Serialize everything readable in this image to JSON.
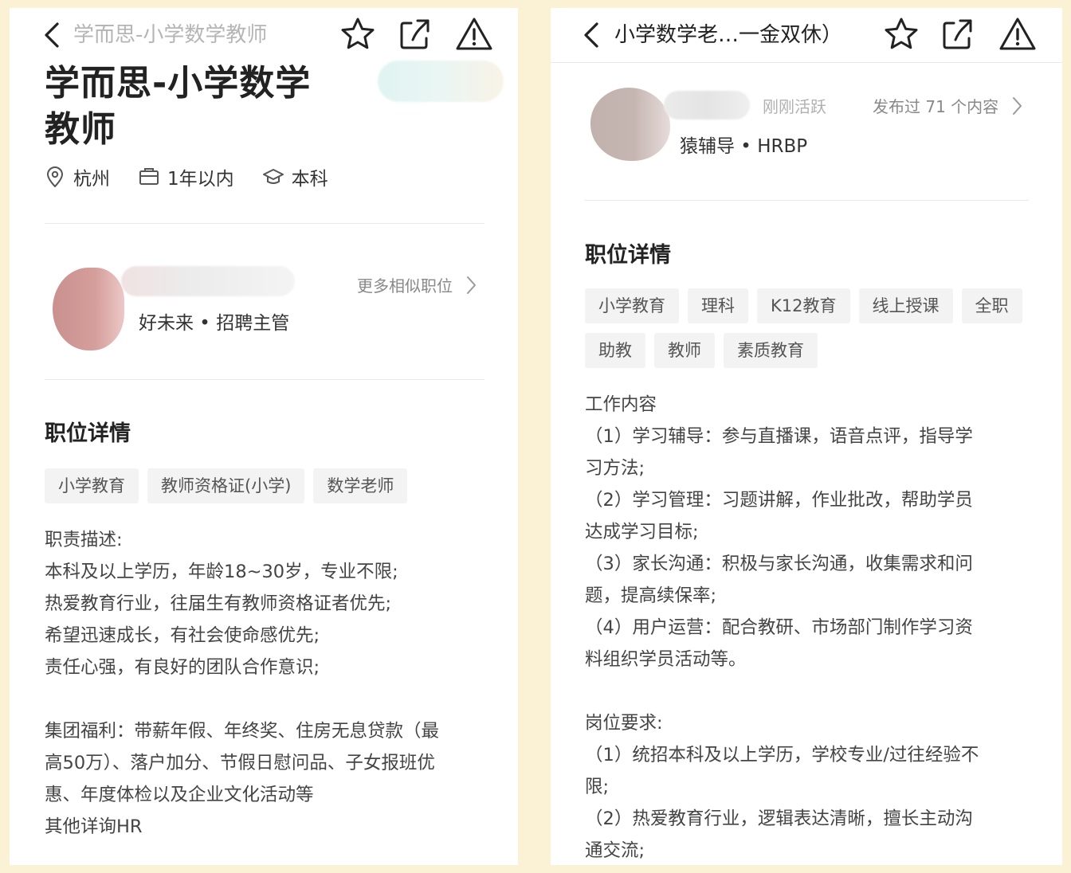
{
  "left": {
    "nav_title": "学而思-小学数学教师",
    "job_title_line1": "学而思-小学数学",
    "job_title_line2": "教师",
    "meta": {
      "location": "杭州",
      "experience": "1年以内",
      "education": "本科"
    },
    "recruiter_role": "好未来 • 招聘主管",
    "more_link": "更多相似职位",
    "section_title": "职位详情",
    "tags": [
      "小学教育",
      "教师资格证(小学)",
      "数学老师"
    ],
    "description_lines": [
      "职责描述:",
      "本科及以上学历，年龄18~30岁，专业不限;",
      "热爱教育行业，往届生有教师资格证者优先;",
      "希望迅速成长，有社会使命感优先;",
      "责任心强，有良好的团队合作意识;",
      "",
      "集团福利：带薪年假、年终奖、住房无息贷款（最",
      "高50万）、落户加分、节假日慰问品、子女报班优",
      "惠、年度体检以及企业文化活动等",
      "其他详询HR"
    ]
  },
  "right": {
    "nav_title": "小学数学老…一金双休）",
    "active_status": "刚刚活跃",
    "posts_link": "发布过 71 个内容",
    "recruiter_role": "猿辅导 • HRBP",
    "section_title": "职位详情",
    "tags": [
      "小学教育",
      "理科",
      "K12教育",
      "线上授课",
      "全职",
      "助教",
      "教师",
      "素质教育"
    ],
    "description_lines": [
      "工作内容",
      "（1）学习辅导：参与直播课，语音点评，指导学",
      "习方法;",
      "（2）学习管理：习题讲解，作业批改，帮助学员",
      "达成学习目标;",
      "（3）家长沟通：积极与家长沟通，收集需求和问",
      "题，提高续保率;",
      "（4）用户运营：配合教研、市场部门制作学习资",
      "料组织学员活动等。",
      "",
      "岗位要求:",
      "（1）统招本科及以上学历，学校专业/过往经验不",
      "限;",
      "（2）热爱教育行业，逻辑表达清晰，擅长主动沟",
      "通交流;"
    ]
  },
  "icons": [
    "back-arrow-icon",
    "star-icon",
    "share-icon",
    "warning-icon",
    "location-pin-icon",
    "briefcase-icon",
    "graduation-cap-icon",
    "chevron-right-icon"
  ],
  "colors": {
    "background": "#fbf1d4",
    "panel": "#ffffff",
    "tag_bg": "#f3f3f3",
    "muted_text": "#888888"
  }
}
